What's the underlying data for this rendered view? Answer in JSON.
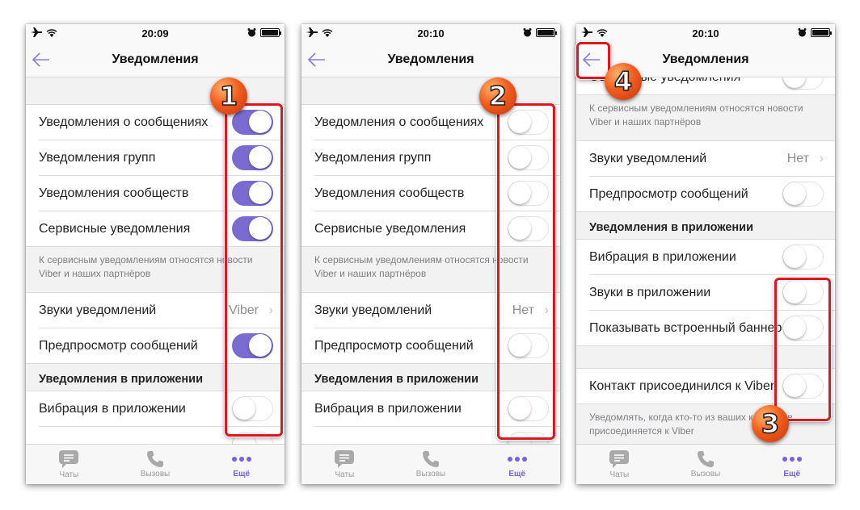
{
  "colors": {
    "accent": "#7a6bd0",
    "highlight": "#e0161e",
    "badge": "#f25d1e"
  },
  "screens": [
    {
      "status": {
        "time": "20:09"
      },
      "nav": {
        "title": "Уведомления",
        "back_icon": "arrow-left-icon"
      },
      "groups": {
        "main": [
          {
            "label": "Уведомления о сообщениях",
            "toggle": true
          },
          {
            "label": "Уведомления групп",
            "toggle": true
          },
          {
            "label": "Уведомления сообществ",
            "toggle": true
          },
          {
            "label": "Сервисные уведомления",
            "toggle": true
          }
        ],
        "service_note": "К сервисным уведомлениям относятся новости Viber и наших партнёров",
        "sound": {
          "label": "Звуки уведомлений",
          "value": "Viber"
        },
        "preview": {
          "label": "Предпросмотр сообщений",
          "toggle": true
        },
        "inapp_header": "Уведомления в приложении",
        "vibration": {
          "label": "Вибрация в приложении",
          "toggle": false
        }
      },
      "badge": "1"
    },
    {
      "status": {
        "time": "20:10"
      },
      "nav": {
        "title": "Уведомления",
        "back_icon": "arrow-left-icon"
      },
      "groups": {
        "main": [
          {
            "label": "Уведомления о сообщениях",
            "toggle": false
          },
          {
            "label": "Уведомления групп",
            "toggle": false
          },
          {
            "label": "Уведомления сообществ",
            "toggle": false
          },
          {
            "label": "Сервисные уведомления",
            "toggle": false
          }
        ],
        "service_note": "К сервисным уведомлениям относятся новости Viber и наших партнёров",
        "sound": {
          "label": "Звуки уведомлений",
          "value": "Нет"
        },
        "preview": {
          "label": "Предпросмотр сообщений",
          "toggle": false
        },
        "inapp_header": "Уведомления в приложении",
        "vibration": {
          "label": "Вибрация в приложении",
          "toggle": false
        }
      },
      "badge": "2"
    },
    {
      "status": {
        "time": "20:10"
      },
      "nav": {
        "title": "Уведомления",
        "back_icon": "arrow-left-icon"
      },
      "groups": {
        "partial_row": {
          "label": "Сервисные уведомления",
          "toggle": false
        },
        "service_note": "К сервисным уведомлениям относятся новости Viber и наших партнёров",
        "sound": {
          "label": "Звуки уведомлений",
          "value": "Нет"
        },
        "preview": {
          "label": "Предпросмотр сообщений",
          "toggle": false
        },
        "inapp_header": "Уведомления в приложении",
        "inapp": [
          {
            "label": "Вибрация в приложении",
            "toggle": false
          },
          {
            "label": "Звуки в приложении",
            "toggle": false
          },
          {
            "label": "Показывать встроенный баннер",
            "toggle": false
          }
        ],
        "contact": {
          "label": "Контакт присоединился к Viber",
          "toggle": false
        },
        "contact_note": "Уведомлять, когда кто-то из ваших контактов присоединяется к Viber"
      },
      "badges": [
        "3",
        "4"
      ]
    }
  ],
  "tabbar": [
    {
      "label": "Чаты",
      "icon": "chat-bubble-icon",
      "active": false
    },
    {
      "label": "Вызовы",
      "icon": "phone-icon",
      "active": false
    },
    {
      "label": "Ещё",
      "icon": "more-dots-icon",
      "active": true
    }
  ]
}
